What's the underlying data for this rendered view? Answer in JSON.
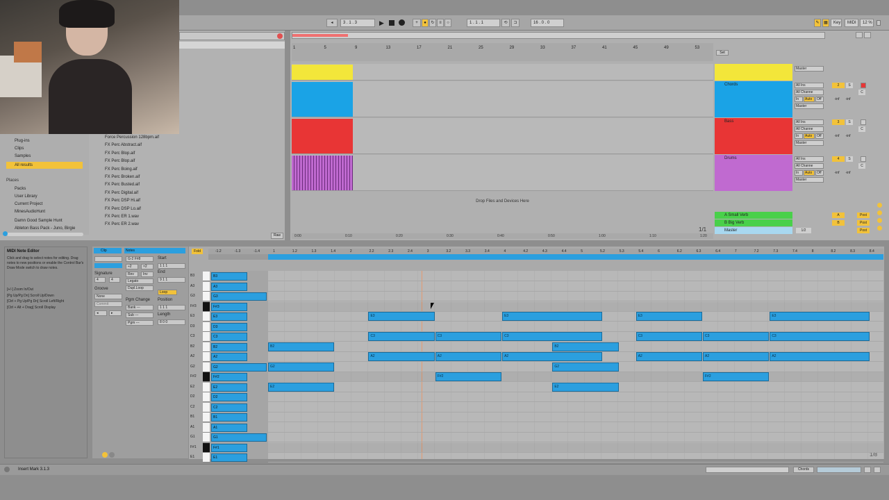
{
  "transport": {
    "tempo_tap": "Tap",
    "position": "3 . 1 . 3",
    "play_icon": "play-icon",
    "stop_icon": "stop-icon",
    "record_icon": "record-icon",
    "loop_start": "1 . 1 . 1",
    "quantize": "16 . 0 . 0",
    "key_label": "Key",
    "midi_label": "MIDI",
    "cpu": "12 %"
  },
  "browser": {
    "categories": [
      "Plug-ins",
      "Clips",
      "Samples",
      "All results"
    ],
    "selected_category": "All results",
    "places_label": "Places",
    "places": [
      "Packs",
      "User Library",
      "Current Project",
      "MinesAudioHunt",
      "Damn Good Sample Hunt",
      "Ableton Bass Pack - Juno, Birgie"
    ],
    "files": [
      "Force Percussion 128bpm.aif",
      "FX Perc Abstract.aif",
      "FX Perc Blop.aif",
      "FX Perc Blop.aif",
      "FX Perc Boing.aif",
      "FX Perc Broken.aif",
      "FX Perc Busted.aif",
      "FX Perc Digital.aif",
      "FX Perc DSP Hi.aif",
      "FX Perc DSP Lo.aif",
      "FX Perc ER 1.wav",
      "FX Perc ER 2.wav"
    ],
    "raw_button": "Raw"
  },
  "arrangement": {
    "ruler": [
      "1",
      "5",
      "9",
      "13",
      "17",
      "21",
      "25",
      "29",
      "33",
      "37",
      "41",
      "45",
      "49",
      "53"
    ],
    "time_ruler": [
      "0:00",
      "0:10",
      "0:20",
      "0:30",
      "0:40",
      "0:50",
      "1:00",
      "1:10",
      "1:20"
    ],
    "drop_text": "Drop Files and Devices Here",
    "page_indicator": "1/1",
    "set_label": "Set",
    "tracks": [
      {
        "name": "",
        "color": "#f3e63a",
        "output": "Master"
      },
      {
        "name": "Chords",
        "color": "#1aa3e6",
        "input": "All Ins",
        "channel": "All Channe",
        "monitor_in": "In",
        "monitor_auto": "Auto",
        "monitor_off": "Off",
        "output": "Master",
        "number": "2"
      },
      {
        "name": "Bass",
        "color": "#e83535",
        "input": "All Ins",
        "channel": "All Channe",
        "monitor_in": "In",
        "monitor_auto": "Auto",
        "monitor_off": "Off",
        "output": "Master",
        "number": "3"
      },
      {
        "name": "Drums",
        "color": "#c06ad0",
        "input": "All Ins",
        "channel": "All Channe",
        "monitor_in": "In",
        "monitor_auto": "Auto",
        "monitor_off": "Off",
        "output": "Master",
        "number": "4"
      }
    ],
    "returns": [
      {
        "name": "A Small Verb",
        "color": "#49d04a",
        "letter": "A",
        "post": "Post"
      },
      {
        "name": "B Big Verb",
        "color": "#49d04a",
        "letter": "B",
        "post": "Post"
      },
      {
        "name": "Master",
        "color": "#a8d8f0",
        "number": "1/2",
        "post": "Post"
      }
    ],
    "inf_text": "-inf",
    "solo_label": "S",
    "cue_label": "C"
  },
  "info_view": {
    "title": "MIDI Note Editor",
    "text": "Click and drag to select notes for editing. Drag notes to new positions or enable the Control Bar's Draw Mode switch to draw notes.",
    "shortcuts": [
      "[+/-] Zoom In/Out",
      "[Pg Up/Pg Dn] Scroll Up/Down",
      "[Ctrl + Pg Up/Pg Dn] Scroll Left/Right",
      "[Ctrl + Alt + Drag] Scroll Display"
    ]
  },
  "clip_panel": {
    "clip_tab": "Clip",
    "notes_tab": "Notes",
    "note_range": "G-2 F#8",
    "start_label": "Start",
    "end_label": "End",
    "loop_label": "Loop",
    "position_label": "Position",
    "length_label": "Length",
    "signature_label": "Signature",
    "sig_num": "4",
    "sig_den": "4",
    "groove_label": "Groove",
    "groove_value": "None",
    "commit_label": "Commit",
    "rev_label": "Rev",
    "inv_label": "Inv",
    "legato_label": "Legato",
    "dupl_loop_label": "Dupl.Loop",
    "pgm_change_label": "Pgm Change",
    "bank_label": "Bank ---",
    "sub_label": "Sub ---",
    "pgm_label": "Pgm ---",
    "start_value": "1  1  1",
    "end_value": "9  1  1",
    "position_value": "1  1  1",
    "length_value": "8  0  0",
    "div2": "÷2",
    "x2": "×2"
  },
  "note_editor": {
    "fold_button": "Fold",
    "beat_ruler": [
      "-1.2",
      "-1.3",
      "-1.4",
      "1",
      "1.2",
      "1.3",
      "1.4",
      "2",
      "2.2",
      "2.3",
      "2.4",
      "3",
      "3.2",
      "3.3",
      "3.4",
      "4",
      "4.2",
      "4.3",
      "4.4",
      "5",
      "5.2",
      "5.3",
      "5.4",
      "6",
      "6.2",
      "6.3",
      "6.4",
      "7",
      "7.2",
      "7.3",
      "7.4",
      "8",
      "8.2",
      "8.3",
      "8.4"
    ],
    "key_labels": [
      "B3",
      "A3",
      "G3",
      "F#3",
      "E3",
      "D3",
      "C3",
      "B2",
      "A2",
      "G2",
      "F#2",
      "E2",
      "D2",
      "C2",
      "B1",
      "A1",
      "G1",
      "F#1",
      "E1"
    ],
    "zoom_indicator": "1/8",
    "notes": [
      {
        "label": "E3",
        "row": 4,
        "start": 1.5,
        "len": 0.5
      },
      {
        "label": "E3",
        "row": 4,
        "start": 3.5,
        "len": 0.75
      },
      {
        "label": "E3",
        "row": 4,
        "start": 5.5,
        "len": 0.5
      },
      {
        "label": "E3",
        "row": 4,
        "start": 7.5,
        "len": 0.75
      },
      {
        "label": "C3",
        "row": 6,
        "start": 1.5,
        "len": 0.5
      },
      {
        "label": "C3",
        "row": 6,
        "start": 2.5,
        "len": 0.5
      },
      {
        "label": "C3",
        "row": 6,
        "start": 3.5,
        "len": 0.75
      },
      {
        "label": "C3",
        "row": 6,
        "start": 5.5,
        "len": 0.5
      },
      {
        "label": "C3",
        "row": 6,
        "start": 6.5,
        "len": 0.5
      },
      {
        "label": "C3",
        "row": 6,
        "start": 7.5,
        "len": 0.75
      },
      {
        "label": "B2",
        "row": 7,
        "start": 0,
        "len": 0.5
      },
      {
        "label": "B2",
        "row": 7,
        "start": 4.25,
        "len": 0.5
      },
      {
        "label": "A2",
        "row": 8,
        "start": 1.5,
        "len": 0.5
      },
      {
        "label": "A2",
        "row": 8,
        "start": 2.5,
        "len": 0.5
      },
      {
        "label": "A2",
        "row": 8,
        "start": 3.5,
        "len": 0.75
      },
      {
        "label": "A2",
        "row": 8,
        "start": 5.5,
        "len": 0.5
      },
      {
        "label": "A2",
        "row": 8,
        "start": 6.5,
        "len": 0.5
      },
      {
        "label": "A2",
        "row": 8,
        "start": 7.5,
        "len": 0.75
      },
      {
        "label": "G2",
        "row": 9,
        "start": 0,
        "len": 0.5
      },
      {
        "label": "G2",
        "row": 9,
        "start": 4.25,
        "len": 0.5
      },
      {
        "label": "F#2",
        "row": 10,
        "start": 2.5,
        "len": 0.5
      },
      {
        "label": "F#2",
        "row": 10,
        "start": 6.5,
        "len": 0.5
      },
      {
        "label": "E2",
        "row": 11,
        "start": 0,
        "len": 0.5
      },
      {
        "label": "E2",
        "row": 11,
        "start": 4.25,
        "len": 0.5
      }
    ]
  },
  "status": {
    "text": "Insert Mark 3.1.3",
    "chords_tab": "Chords"
  }
}
